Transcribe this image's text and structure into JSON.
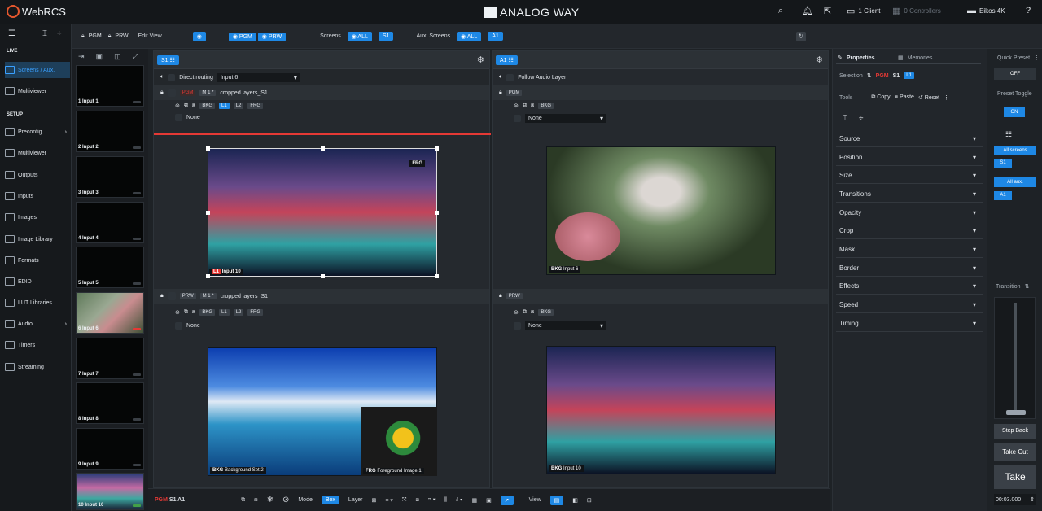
{
  "app": {
    "name": "WebRCS",
    "brand": "ANALOG WAY"
  },
  "topbar": {
    "clients": "1 Client",
    "controllers": "0 Controllers",
    "device": "Eikos 4K"
  },
  "sidebar": {
    "live_title": "LIVE",
    "setup_title": "SETUP",
    "live_items": [
      "Screens / Aux.",
      "Multiviewer"
    ],
    "setup_items": [
      "Preconfig",
      "Multiviewer",
      "Outputs",
      "Inputs",
      "Images",
      "Image Library",
      "Formats",
      "EDID",
      "LUT Libraries",
      "Audio",
      "Timers",
      "Streaming"
    ]
  },
  "toolbar": {
    "pgm_lock": "PGM",
    "prw_lock": "PRW",
    "edit_view": "Edit View",
    "view_pgm": "PGM",
    "view_prw": "PRW",
    "screens_label": "Screens",
    "screens_all": "ALL",
    "screens_s1": "S1",
    "aux_label": "Aux. Screens",
    "aux_all": "ALL",
    "aux_a1": "A1"
  },
  "inputs": [
    "1 Input 1",
    "2 Input 2",
    "3 Input 3",
    "4 Input 4",
    "5 Input 5",
    "6 Input 6",
    "7 Input 7",
    "8 Input 8",
    "9 Input 9",
    "10 Input 10"
  ],
  "screen_s1": {
    "tab": "S1",
    "routing": "Direct routing",
    "routing_value": "Input 6",
    "pgm_tag": "PGM",
    "pgm_memory": "M 1 *",
    "pgm_name": "cropped layers_S1",
    "layers": [
      "BKG",
      "L1",
      "L2",
      "FRG"
    ],
    "pgm_none": "None",
    "frg_tag": "FRG",
    "l1_tag": "L1",
    "l1_input": "Input 10",
    "prw_tag": "PRW",
    "prw_memory": "M 1 *",
    "prw_name": "cropped layers_S1",
    "prw_none": "None",
    "prw_bkg": "BKG",
    "prw_bkg_name": "Background Set 2",
    "prw_frg": "FRG",
    "prw_frg_name": "Foreground Image 1"
  },
  "screen_a1": {
    "tab": "A1",
    "audio": "Follow Audio Layer",
    "pgm_tag": "PGM",
    "pgm_layer": "BKG",
    "pgm_none": "None",
    "pgm_bkg": "BKG",
    "pgm_bkg_input": "Input 6",
    "prw_tag": "PRW",
    "prw_layer": "BKG",
    "prw_none": "None",
    "prw_bkg": "BKG",
    "prw_bkg_input": "Input 10"
  },
  "properties": {
    "tab_properties": "Properties",
    "tab_memories": "Memories",
    "selection_label": "Selection",
    "sel_pgm": "PGM",
    "sel_s1": "S1",
    "sel_l1": "L1",
    "tools_label": "Tools",
    "copy": "Copy",
    "paste": "Paste",
    "reset": "Reset",
    "sections": [
      "Source",
      "Position",
      "Size",
      "Transitions",
      "Opacity",
      "Crop",
      "Mask",
      "Border",
      "Effects",
      "Speed",
      "Timing"
    ]
  },
  "quick": {
    "title": "Quick Preset",
    "off": "OFF",
    "toggle_title": "Preset Toggle",
    "on": "ON",
    "all_screens": "All screens",
    "s1": "S1",
    "all_aux": "All aux.",
    "a1": "A1",
    "transition_title": "Transition",
    "step_back": "Step Back",
    "take_cut": "Take Cut",
    "take": "Take",
    "duration": "00:03.000"
  },
  "bottombar": {
    "pgm_label": "PGM",
    "screens": "S1 A1",
    "mode_label": "Mode",
    "mode_box": "Box",
    "mode_layer": "Layer",
    "view_label": "View"
  },
  "colors": {
    "accent": "#1e88e5",
    "alert": "#e53935",
    "bg": "#1e2226"
  }
}
